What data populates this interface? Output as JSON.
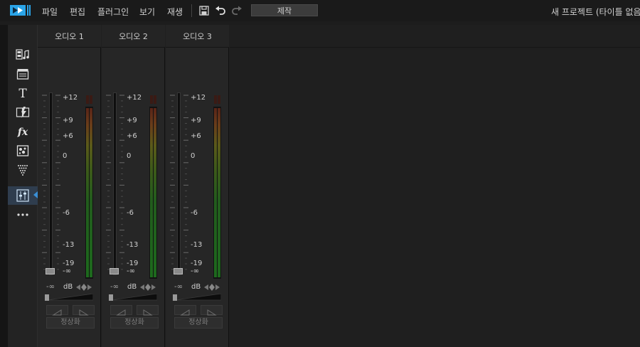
{
  "menu": {
    "items": [
      "파일",
      "편집",
      "플러그인",
      "보기",
      "재생"
    ],
    "produce_label": "제작",
    "project_title": "새 프로젝트 (타이틀 없음)"
  },
  "sidebar": {
    "items": [
      {
        "icon": "media-room-icon"
      },
      {
        "icon": "title-clapper-icon"
      },
      {
        "icon": "text-title-icon"
      },
      {
        "icon": "transition-icon"
      },
      {
        "icon": "fx-icon"
      },
      {
        "icon": "pip-objects-icon"
      },
      {
        "icon": "particle-icon"
      },
      {
        "icon": "audio-mixer-icon",
        "active": true
      },
      {
        "icon": "more-icon"
      }
    ]
  },
  "mixer": {
    "channels": [
      {
        "name": "오디오 1"
      },
      {
        "name": "오디오 2"
      },
      {
        "name": "오디오 3"
      }
    ],
    "scale": [
      "+12",
      "+9",
      "+6",
      "0",
      "-6",
      "-13",
      "-19",
      "-∞"
    ],
    "db_label": "dB",
    "neg_inf_label": "-∞",
    "normalize_label": "정상화"
  },
  "colors": {
    "accent": "#3a8fd6",
    "logo": "#2aa4e8",
    "meter_green": "#1d6a1d",
    "meter_red": "#5a2418"
  }
}
